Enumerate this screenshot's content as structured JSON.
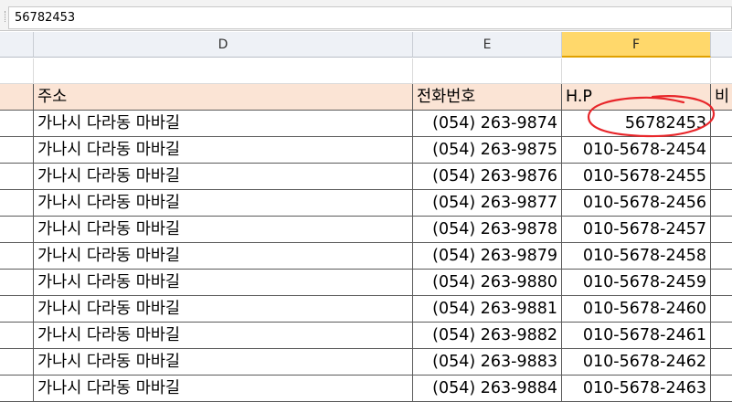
{
  "formula_bar": {
    "value": "56782453"
  },
  "columns": [
    "D",
    "E",
    "F"
  ],
  "header_row": {
    "address": "주소",
    "phone": "전화번호",
    "hp": "H.P",
    "extra": "비"
  },
  "rows": [
    {
      "address": "가나시 다라동 마바길",
      "phone": "(054) 263-9874",
      "hp": "56782453"
    },
    {
      "address": "가나시 다라동 마바길",
      "phone": "(054) 263-9875",
      "hp": "010-5678-2454"
    },
    {
      "address": "가나시 다라동 마바길",
      "phone": "(054) 263-9876",
      "hp": "010-5678-2455"
    },
    {
      "address": "가나시 다라동 마바길",
      "phone": "(054) 263-9877",
      "hp": "010-5678-2456"
    },
    {
      "address": "가나시 다라동 마바길",
      "phone": "(054) 263-9878",
      "hp": "010-5678-2457"
    },
    {
      "address": "가나시 다라동 마바길",
      "phone": "(054) 263-9879",
      "hp": "010-5678-2458"
    },
    {
      "address": "가나시 다라동 마바길",
      "phone": "(054) 263-9880",
      "hp": "010-5678-2459"
    },
    {
      "address": "가나시 다라동 마바길",
      "phone": "(054) 263-9881",
      "hp": "010-5678-2460"
    },
    {
      "address": "가나시 다라동 마바길",
      "phone": "(054) 263-9882",
      "hp": "010-5678-2461"
    },
    {
      "address": "가나시 다라동 마바길",
      "phone": "(054) 263-9883",
      "hp": "010-5678-2462"
    },
    {
      "address": "가나시 다라동 마바길",
      "phone": "(054) 263-9884",
      "hp": "010-5678-2463"
    }
  ],
  "colors": {
    "header_fill": "#fbe4d5",
    "selected_column": "#ffd86b",
    "annotation": "#e8262a"
  }
}
